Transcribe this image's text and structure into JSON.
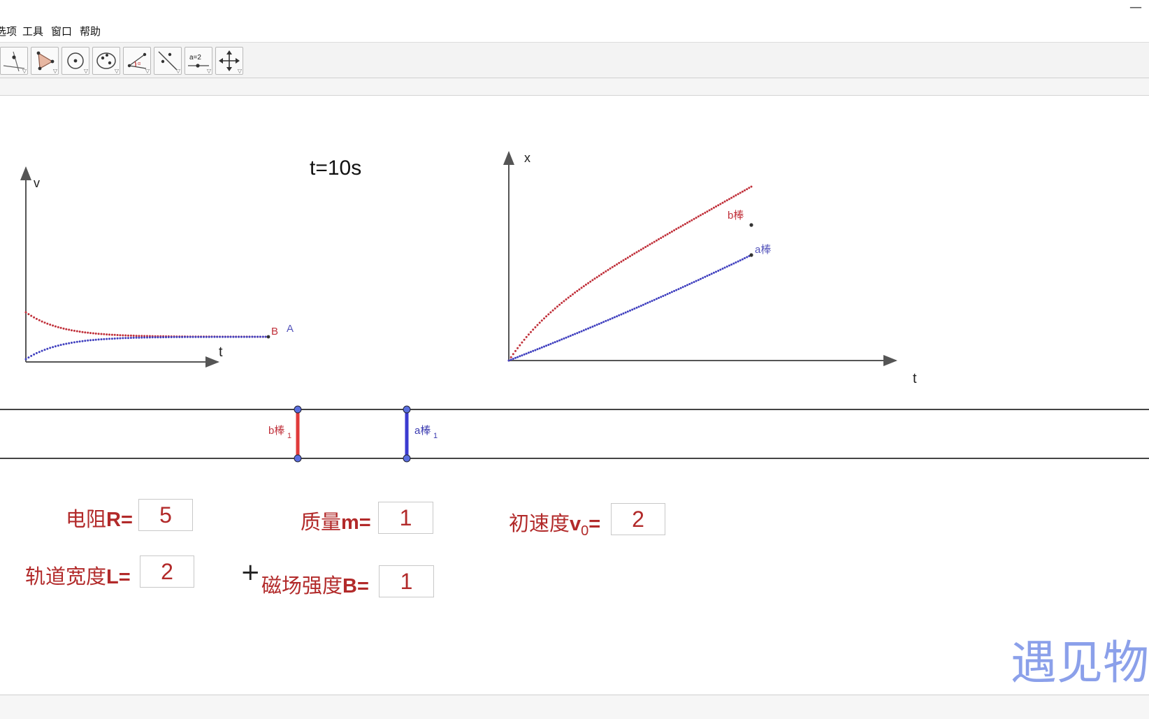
{
  "menu": {
    "items": [
      "选项",
      "工具",
      "窗口",
      "帮助"
    ]
  },
  "toolbar": {
    "tools": [
      {
        "icon": "point-icon"
      },
      {
        "icon": "polygon-icon"
      },
      {
        "icon": "circle-icon"
      },
      {
        "icon": "ellipse-icon"
      },
      {
        "icon": "angle-icon"
      },
      {
        "icon": "reflect-line-icon"
      },
      {
        "icon": "slider-icon",
        "text": "a=2"
      },
      {
        "icon": "move-view-icon"
      }
    ]
  },
  "canvas": {
    "time_label": "t=10s",
    "vt_graph": {
      "y_label": "v",
      "x_label": "t",
      "label_b": "B",
      "label_a": "A"
    },
    "xt_graph": {
      "y_label": "x",
      "x_label": "t",
      "label_b": "b棒",
      "label_a": "a棒"
    },
    "rails": {
      "rod_b_label": "b棒",
      "rod_b_sub": "1",
      "rod_a_label": "a棒",
      "rod_a_sub": "1"
    },
    "params": {
      "resistance": {
        "label_cn": "电阻",
        "label_sym": "R=",
        "value": "5"
      },
      "mass": {
        "label_cn": "质量",
        "label_sym": "m=",
        "value": "1"
      },
      "velocity": {
        "label_cn": "初速度",
        "label_sym": "v",
        "label_sub": "0",
        "label_eq": "=",
        "value": "2"
      },
      "width": {
        "label_cn": "轨道宽度",
        "label_sym": "L=",
        "value": "2"
      },
      "field": {
        "label_cn": "磁场强度",
        "label_sym": "B=",
        "value": "1"
      }
    },
    "cursor": "+",
    "watermark": "遇见物理"
  },
  "colors": {
    "b_rod": "#c0303a",
    "a_rod": "#4040bf",
    "param_text": "#b22a2a",
    "watermark": "#7f96e8"
  }
}
